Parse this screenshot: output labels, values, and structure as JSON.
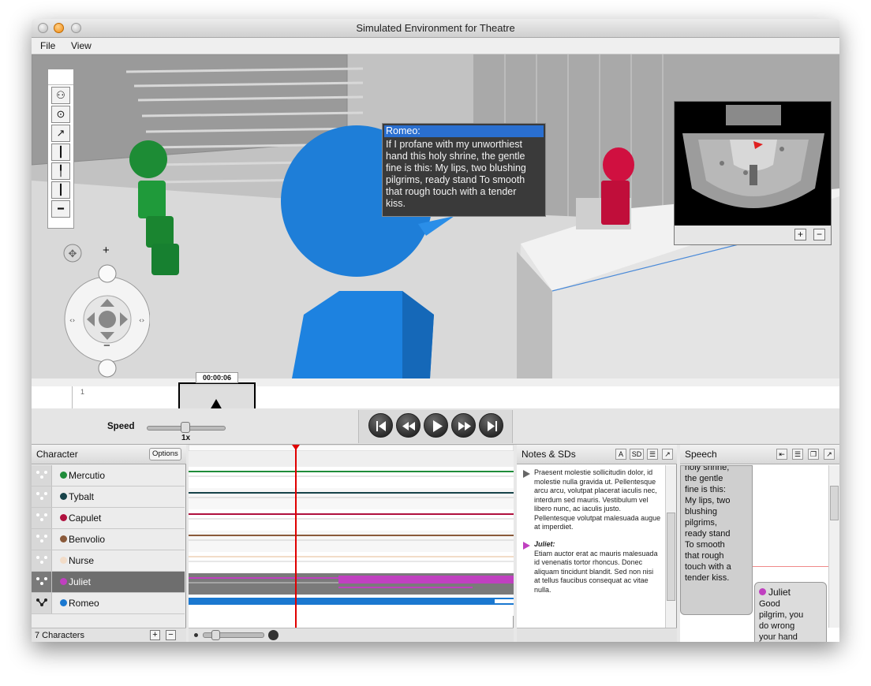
{
  "window": {
    "title": "Simulated Environment for Theatre"
  },
  "menu": {
    "items": [
      "File",
      "View"
    ]
  },
  "scene": {
    "speech_bubble": {
      "speaker": "Romeo:",
      "lines": [
        "If I profane with my unworthiest",
        "hand this holy shrine, the gentle",
        "fine is this: My lips, two blushing",
        "pilgrims, ready stand To smooth",
        "that rough touch with a tender",
        "kiss."
      ]
    },
    "minimap": {
      "zoom_in": "+",
      "zoom_out": "−"
    },
    "navigation": {
      "zoom_in": "+",
      "zoom_out": "−"
    }
  },
  "timeline": {
    "time": "00:00:06",
    "ruler_mark": "1"
  },
  "transport": {
    "speed_label": "Speed",
    "speed_value": "1x"
  },
  "characters": {
    "header": "Character",
    "options_label": "Options",
    "count_label": "7 Characters",
    "add": "+",
    "remove": "−",
    "list": [
      {
        "name": "Mercutio",
        "color": "#1f8c3a"
      },
      {
        "name": "Tybalt",
        "color": "#17434a"
      },
      {
        "name": "Capulet",
        "color": "#b0103e"
      },
      {
        "name": "Benvolio",
        "color": "#8a5a3a"
      },
      {
        "name": "Nurse",
        "color": "#f2dcc8"
      },
      {
        "name": "Juliet",
        "color": "#c040c0"
      },
      {
        "name": "Romeo",
        "color": "#1a78d0"
      }
    ]
  },
  "notes": {
    "header": "Notes & SDs",
    "btn_a": "A",
    "btn_sd": "SD",
    "entry1": [
      "Praesent molestie sollicitudin dolor, id",
      "molestie nulla gravida ut. Pellentesque",
      "arcu arcu, volutpat placerat iaculis nec,",
      "interdum sed mauris. Vestibulum vel",
      "libero nunc, ac iaculis justo.",
      "Pellentesque volutpat malesuada augue",
      "at imperdiet."
    ],
    "entry2_title": "Juliet:",
    "entry2": [
      "Etiam auctor erat ac mauris malesuada",
      "id venenatis tortor rhoncus. Donec",
      "aliquam tincidunt blandit. Sed non nisi",
      "at tellus faucibus consequat ac vitae",
      "nulla."
    ]
  },
  "speech": {
    "header": "Speech",
    "romeo_lines": [
      "holy shrine,",
      "the gentle",
      "fine is this:",
      "My lips, two",
      "blushing",
      "pilgrims,",
      "ready stand",
      "To smooth",
      "that rough",
      "touch with a",
      "tender kiss."
    ],
    "juliet_name": "Juliet",
    "juliet_lines": [
      "Good",
      "pilgrim, you",
      "do wrong",
      "your hand"
    ]
  },
  "colors": {
    "accent": "#2a6fd0",
    "playhead": "#e00000",
    "juliet": "#c040c0",
    "romeo": "#1a78d0"
  }
}
